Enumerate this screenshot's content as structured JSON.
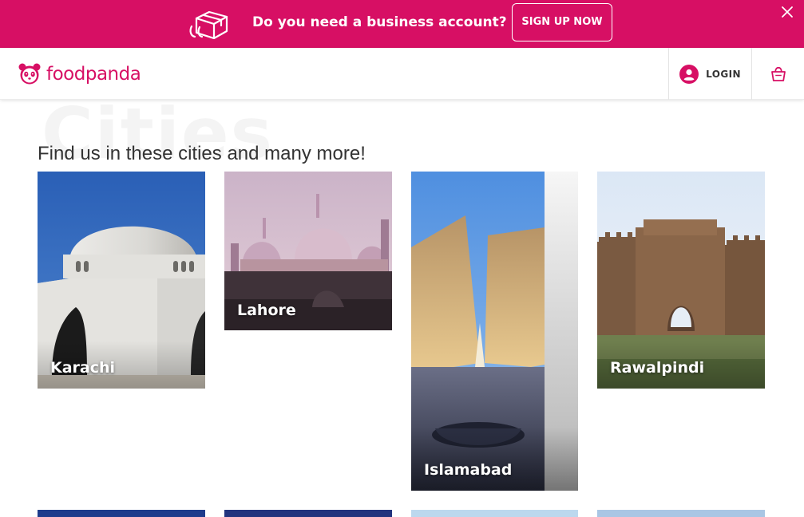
{
  "promo": {
    "text": "Do you need a business account?",
    "button_label": "SIGN UP NOW"
  },
  "header": {
    "brand": "foodpanda",
    "login_label": "LOGIN"
  },
  "cities_section": {
    "watermark": "Cities",
    "subtitle": "Find us in these cities and many more!",
    "cities": [
      {
        "name": "Karachi"
      },
      {
        "name": "Lahore"
      },
      {
        "name": "Islamabad"
      },
      {
        "name": "Rawalpindi"
      }
    ]
  },
  "colors": {
    "brand": "#d70f64",
    "text": "#333333"
  },
  "icons": [
    "business-box-icon",
    "close-icon",
    "panda-logo-icon",
    "user-icon",
    "shopping-bag-icon"
  ]
}
